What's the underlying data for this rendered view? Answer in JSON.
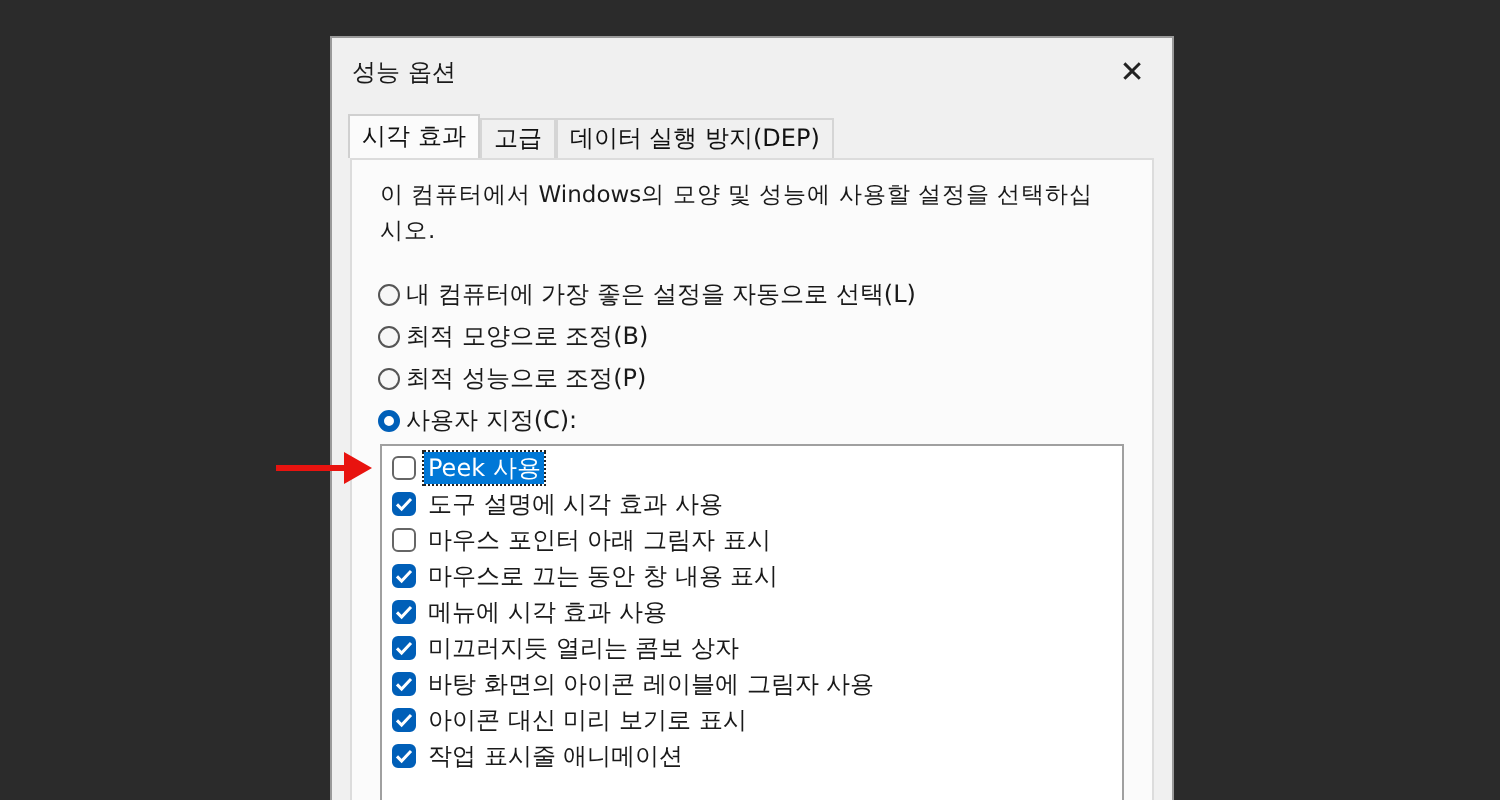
{
  "window": {
    "title": "성능 옵션",
    "close": "✕"
  },
  "tabs": [
    {
      "label": "시각 효과",
      "selected": true
    },
    {
      "label": "고급",
      "selected": false
    },
    {
      "label": "데이터 실행 방지(DEP)",
      "selected": false
    }
  ],
  "description": "이 컴퓨터에서 Windows의 모양 및 성능에 사용할 설정을 선택하십시오.",
  "options": [
    {
      "label": "내 컴퓨터에 가장 좋은 설정을 자동으로 선택(L)",
      "selected": false
    },
    {
      "label": "최적 모양으로 조정(B)",
      "selected": false
    },
    {
      "label": "최적 성능으로 조정(P)",
      "selected": false
    },
    {
      "label": "사용자 지정(C):",
      "selected": true
    }
  ],
  "effects": [
    {
      "label": "Peek 사용",
      "checked": false,
      "focused": true
    },
    {
      "label": "도구 설명에 시각 효과 사용",
      "checked": true,
      "focused": false
    },
    {
      "label": "마우스 포인터 아래 그림자 표시",
      "checked": false,
      "focused": false
    },
    {
      "label": "마우스로 끄는 동안 창 내용 표시",
      "checked": true,
      "focused": false
    },
    {
      "label": "메뉴에 시각 효과 사용",
      "checked": true,
      "focused": false
    },
    {
      "label": "미끄러지듯 열리는 콤보 상자",
      "checked": true,
      "focused": false
    },
    {
      "label": "바탕 화면의 아이콘 레이블에 그림자 사용",
      "checked": true,
      "focused": false
    },
    {
      "label": "아이콘 대신 미리 보기로 표시",
      "checked": true,
      "focused": false
    },
    {
      "label": "작업 표시줄 애니메이션",
      "checked": true,
      "focused": false
    }
  ]
}
